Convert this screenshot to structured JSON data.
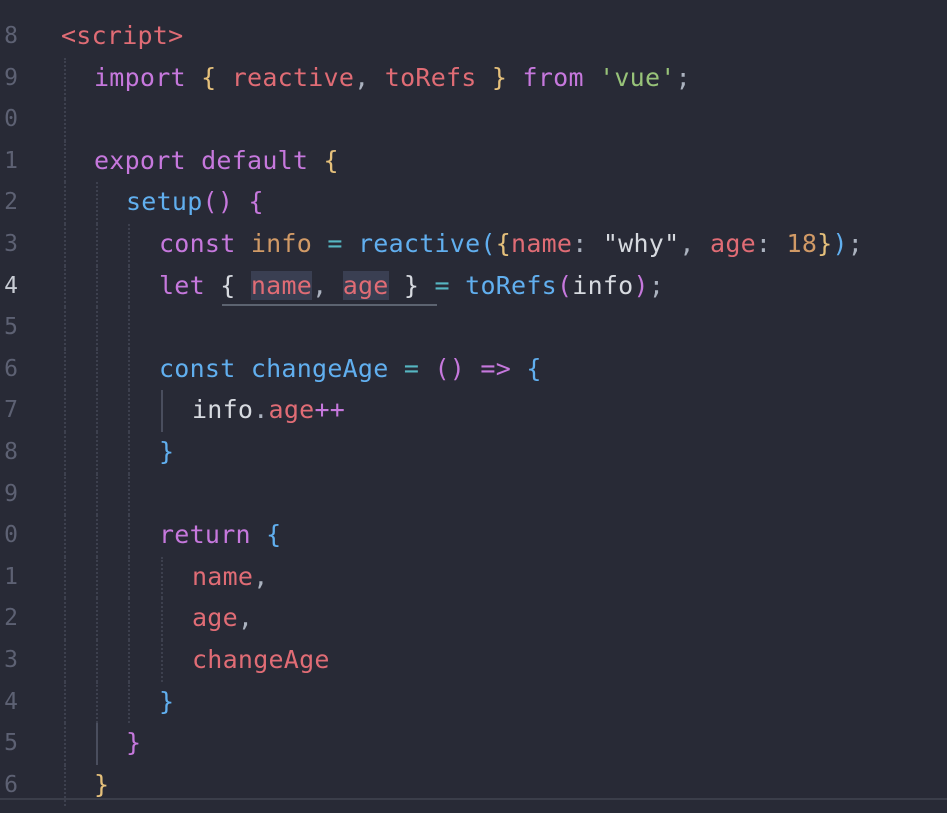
{
  "editor": {
    "language": "vue",
    "theme_background": "#282a36",
    "lines": [
      {
        "num": "8"
      },
      {
        "num": "9"
      },
      {
        "num": "0"
      },
      {
        "num": "1"
      },
      {
        "num": "2"
      },
      {
        "num": "3"
      },
      {
        "num": "4"
      },
      {
        "num": "5"
      },
      {
        "num": "6"
      },
      {
        "num": "7"
      },
      {
        "num": "8"
      },
      {
        "num": "9"
      },
      {
        "num": "0"
      },
      {
        "num": "1"
      },
      {
        "num": "2"
      },
      {
        "num": "3"
      },
      {
        "num": "4"
      },
      {
        "num": "5"
      },
      {
        "num": "6"
      }
    ],
    "tokens": {
      "l8_open": "<script>",
      "l9_import": "import",
      "l9_lbrace": "{",
      "l9_reactive": "reactive",
      "l9_comma": ",",
      "l9_torefs": "toRefs",
      "l9_rbrace": "}",
      "l9_from": "from",
      "l9_str": "'vue'",
      "l9_semi": ";",
      "l11_export": "export",
      "l11_default": "default",
      "l11_lbrace": "{",
      "l12_setup": "setup",
      "l12_parens": "()",
      "l12_lbrace": "{",
      "l13_const": "const",
      "l13_info": "info",
      "l13_eq": "=",
      "l13_reactive": "reactive",
      "l13_lparen": "(",
      "l13_lbrace": "{",
      "l13_name": "name",
      "l13_colon1": ":",
      "l13_why": "\"why\"",
      "l13_comma": ",",
      "l13_age": "age",
      "l13_colon2": ":",
      "l13_num": "18",
      "l13_rbrace": "}",
      "l13_rparen": ")",
      "l13_semi": ";",
      "l14_let": "let",
      "l14_lbrace": "{",
      "l14_name": "name",
      "l14_comma": ",",
      "l14_age": "age",
      "l14_rbrace": "}",
      "l14_eq": "=",
      "l14_torefs": "toRefs",
      "l14_lparen": "(",
      "l14_info": "info",
      "l14_rparen": ")",
      "l14_semi": ";",
      "l16_const": "const",
      "l16_changeage": "changeAge",
      "l16_eq": "=",
      "l16_parens": "()",
      "l16_arrow": "=>",
      "l16_lbrace": "{",
      "l17_info": "info",
      "l17_dot": ".",
      "l17_age": "age",
      "l17_inc": "++",
      "l18_rbrace": "}",
      "l20_return": "return",
      "l20_lbrace": "{",
      "l21_name": "name",
      "l21_comma": ",",
      "l22_age": "age",
      "l22_comma": ",",
      "l23_changeage": "changeAge",
      "l24_rbrace": "}",
      "l25_rbrace": "}",
      "l26_rbrace": "}"
    }
  }
}
